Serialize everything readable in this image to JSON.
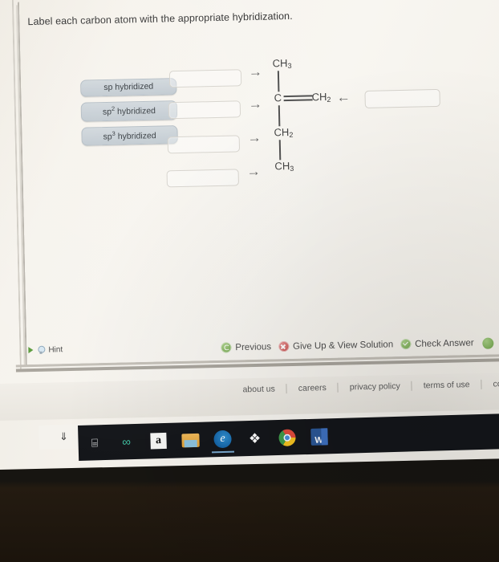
{
  "question": {
    "prompt": "Label each carbon atom with the appropriate hybridization."
  },
  "tiles": [
    {
      "label": "sp hybridized",
      "base": "sp",
      "sup": ""
    },
    {
      "label": "sp2 hybridized",
      "base": "sp",
      "sup": "2"
    },
    {
      "label": "sp3 hybridized",
      "base": "sp",
      "sup": "3"
    }
  ],
  "drop_targets": [
    {
      "name": "drop-target-1",
      "value": ""
    },
    {
      "name": "drop-target-2",
      "value": ""
    },
    {
      "name": "drop-target-3",
      "value": ""
    },
    {
      "name": "drop-target-4",
      "value": ""
    },
    {
      "name": "drop-target-5",
      "value": ""
    }
  ],
  "arrows": {
    "right": "→",
    "left": "←"
  },
  "molecule": {
    "atoms": [
      {
        "name": "atom-ch3-top",
        "base": "CH",
        "sub": "3"
      },
      {
        "name": "atom-c-center",
        "base": "C",
        "sub": ""
      },
      {
        "name": "atom-ch2-right",
        "base": "CH",
        "sub": "2"
      },
      {
        "name": "atom-ch2-lower",
        "base": "CH",
        "sub": "2"
      },
      {
        "name": "atom-ch3-bottom",
        "base": "CH",
        "sub": "3"
      }
    ]
  },
  "hint": {
    "label": "Hint",
    "triangle_color": "#5a9b3c"
  },
  "actions": [
    {
      "label": "Previous",
      "icon": "previous-circle-icon",
      "color": "#6fa34a"
    },
    {
      "label": "Give Up & View Solution",
      "icon": "give-up-circle-icon",
      "color": "#c24a47"
    },
    {
      "label": "Check Answer",
      "icon": "check-circle-icon",
      "color": "#6fa34a"
    }
  ],
  "next_button": {
    "label": "",
    "icon": "next-circle-icon",
    "color": "#6fa34a"
  },
  "footer": {
    "links": [
      "about us",
      "careers",
      "privacy policy",
      "terms of use",
      "cont"
    ]
  },
  "taskbar": {
    "tray_arrow": "⇓",
    "items": [
      {
        "name": "task-view-icon",
        "glyph": "⌸"
      },
      {
        "name": "infinity-icon",
        "glyph": "∞"
      },
      {
        "name": "amazon-icon",
        "glyph": "a"
      },
      {
        "name": "file-explorer-icon",
        "glyph": ""
      },
      {
        "name": "edge-icon",
        "glyph": "e"
      },
      {
        "name": "dropbox-icon",
        "glyph": "❖"
      },
      {
        "name": "chrome-icon",
        "glyph": ""
      },
      {
        "name": "word-icon",
        "glyph": "W"
      }
    ]
  },
  "colors": {
    "page_background": "#f5f2ec",
    "tile_background": "#c7cfd6",
    "accent_green": "#6fa34a",
    "accent_red": "#c24a47",
    "taskbar": "#14161a"
  }
}
